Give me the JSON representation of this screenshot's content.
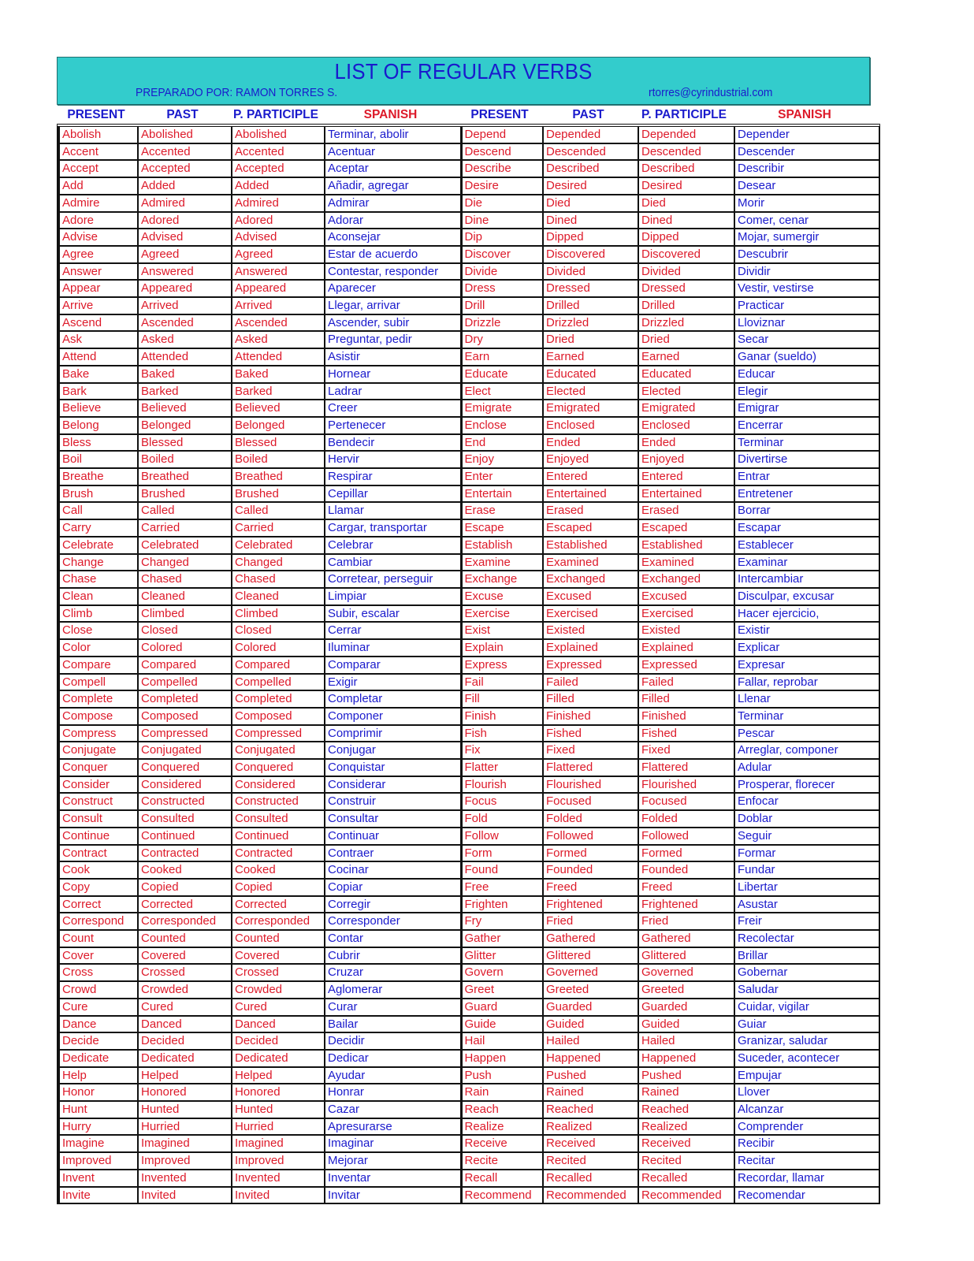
{
  "banner": {
    "title": "LIST OF REGULAR VERBS",
    "author": "PREPARADO POR: RAMON TORRES S.",
    "email": "rtorres@cyrindustrial.com"
  },
  "colors": {
    "banner_bg": "#33cccc",
    "english_text": "#dd1a2a",
    "spanish_text": "#1a1acc",
    "header_blue": "#1a1acc",
    "header_red": "#dd1a2a"
  },
  "headers": [
    "PRESENT",
    "PAST",
    "P. PARTICIPLE",
    "SPANISH",
    "PRESENT",
    "PAST",
    "P. PARTICIPLE",
    "SPANISH"
  ],
  "left_rows": [
    [
      "Abolish",
      "Abolished",
      "Abolished",
      "Terminar, abolir"
    ],
    [
      "Accent",
      "Accented",
      "Accented",
      "Acentuar"
    ],
    [
      "Accept",
      "Accepted",
      "Accepted",
      "Aceptar"
    ],
    [
      "Add",
      "Added",
      "Added",
      "Añadir, agregar"
    ],
    [
      "Admire",
      "Admired",
      "Admired",
      "Admirar"
    ],
    [
      "Adore",
      "Adored",
      "Adored",
      "Adorar"
    ],
    [
      "Advise",
      "Advised",
      "Advised",
      "Aconsejar"
    ],
    [
      "Agree",
      "Agreed",
      "Agreed",
      "Estar de acuerdo"
    ],
    [
      "Answer",
      "Answered",
      "Answered",
      "Contestar, responder"
    ],
    [
      "Appear",
      "Appeared",
      "Appeared",
      "Aparecer"
    ],
    [
      "Arrive",
      "Arrived",
      "Arrived",
      "Llegar, arrivar"
    ],
    [
      "Ascend",
      "Ascended",
      "Ascended",
      "Ascender, subir"
    ],
    [
      "Ask",
      "Asked",
      "Asked",
      "Preguntar, pedir"
    ],
    [
      "Attend",
      "Attended",
      "Attended",
      "Asistir"
    ],
    [
      "Bake",
      "Baked",
      "Baked",
      "Hornear"
    ],
    [
      "Bark",
      "Barked",
      "Barked",
      "Ladrar"
    ],
    [
      "Believe",
      "Believed",
      "Believed",
      "Creer"
    ],
    [
      "Belong",
      "Belonged",
      "Belonged",
      "Pertenecer"
    ],
    [
      "Bless",
      "Blessed",
      "Blessed",
      "Bendecir"
    ],
    [
      "Boil",
      "Boiled",
      "Boiled",
      "Hervir"
    ],
    [
      "Breathe",
      "Breathed",
      "Breathed",
      "Respirar"
    ],
    [
      "Brush",
      "Brushed",
      "Brushed",
      "Cepillar"
    ],
    [
      "Call",
      "Called",
      "Called",
      "Llamar"
    ],
    [
      "Carry",
      "Carried",
      "Carried",
      "Cargar, transportar"
    ],
    [
      "Celebrate",
      "Celebrated",
      "Celebrated",
      "Celebrar"
    ],
    [
      "Change",
      "Changed",
      "Changed",
      "Cambiar"
    ],
    [
      "Chase",
      "Chased",
      "Chased",
      "Corretear, perseguir"
    ],
    [
      "Clean",
      "Cleaned",
      "Cleaned",
      "Limpiar"
    ],
    [
      "Climb",
      "Climbed",
      "Climbed",
      "Subir, escalar"
    ],
    [
      "Close",
      "Closed",
      "Closed",
      "Cerrar"
    ],
    [
      "Color",
      "Colored",
      "Colored",
      "Iluminar"
    ],
    [
      "Compare",
      "Compared",
      "Compared",
      "Comparar"
    ],
    [
      "Compell",
      "Compelled",
      "Compelled",
      "Exigir"
    ],
    [
      "Complete",
      "Completed",
      "Completed",
      "Completar"
    ],
    [
      "Compose",
      "Composed",
      "Composed",
      "Componer"
    ],
    [
      "Compress",
      "Compressed",
      "Compressed",
      "Comprimir"
    ],
    [
      "Conjugate",
      "Conjugated",
      "Conjugated",
      "Conjugar"
    ],
    [
      "Conquer",
      "Conquered",
      "Conquered",
      "Conquistar"
    ],
    [
      "Consider",
      "Considered",
      "Considered",
      "Considerar"
    ],
    [
      "Construct",
      "Constructed",
      "Constructed",
      "Construir"
    ],
    [
      "Consult",
      "Consulted",
      "Consulted",
      "Consultar"
    ],
    [
      "Continue",
      "Continued",
      "Continued",
      "Continuar"
    ],
    [
      "Contract",
      "Contracted",
      "Contracted",
      "Contraer"
    ],
    [
      "Cook",
      "Cooked",
      "Cooked",
      "Cocinar"
    ],
    [
      "Copy",
      "Copied",
      "Copied",
      "Copiar"
    ],
    [
      "Correct",
      "Corrected",
      "Corrected",
      "Corregir"
    ],
    [
      "Correspond",
      "Corresponded",
      "Corresponded",
      "Corresponder"
    ],
    [
      "Count",
      "Counted",
      "Counted",
      "Contar"
    ],
    [
      "Cover",
      "Covered",
      "Covered",
      "Cubrir"
    ],
    [
      "Cross",
      "Crossed",
      "Crossed",
      "Cruzar"
    ],
    [
      "Crowd",
      "Crowded",
      "Crowded",
      "Aglomerar"
    ],
    [
      "Cure",
      "Cured",
      "Cured",
      "Curar"
    ],
    [
      "Dance",
      "Danced",
      "Danced",
      "Bailar"
    ],
    [
      "Decide",
      "Decided",
      "Decided",
      "Decidir"
    ],
    [
      "Dedicate",
      "Dedicated",
      "Dedicated",
      "Dedicar"
    ],
    [
      "Help",
      "Helped",
      "Helped",
      "Ayudar"
    ],
    [
      "Honor",
      "Honored",
      "Honored",
      "Honrar"
    ],
    [
      "Hunt",
      "Hunted",
      "Hunted",
      "Cazar"
    ],
    [
      "Hurry",
      "Hurried",
      "Hurried",
      "Apresurarse"
    ],
    [
      "Imagine",
      "Imagined",
      "Imagined",
      "Imaginar"
    ],
    [
      "Improved",
      "Improved",
      "Improved",
      "Mejorar"
    ],
    [
      "Invent",
      "Invented",
      "Invented",
      "Inventar"
    ],
    [
      "Invite",
      "Invited",
      "Invited",
      "Invitar"
    ]
  ],
  "right_rows": [
    [
      "Depend",
      "Depended",
      "Depended",
      "Depender"
    ],
    [
      "Descend",
      "Descended",
      "Descended",
      "Descender"
    ],
    [
      "Describe",
      "Described",
      "Described",
      "Describir"
    ],
    [
      "Desire",
      "Desired",
      "Desired",
      "Desear"
    ],
    [
      "Die",
      "Died",
      "Died",
      "Morir"
    ],
    [
      "Dine",
      "Dined",
      "Dined",
      "Comer, cenar"
    ],
    [
      "Dip",
      "Dipped",
      "Dipped",
      "Mojar, sumergir"
    ],
    [
      "Discover",
      "Discovered",
      "Discovered",
      "Descubrir"
    ],
    [
      "Divide",
      "Divided",
      "Divided",
      "Dividir"
    ],
    [
      "Dress",
      "Dressed",
      "Dressed",
      "Vestir, vestirse"
    ],
    [
      "Drill",
      "Drilled",
      "Drilled",
      "Practicar"
    ],
    [
      "Drizzle",
      "Drizzled",
      "Drizzled",
      "Lloviznar"
    ],
    [
      "Dry",
      "Dried",
      "Dried",
      "Secar"
    ],
    [
      "Earn",
      "Earned",
      "Earned",
      "Ganar (sueldo)"
    ],
    [
      "Educate",
      "Educated",
      "Educated",
      "Educar"
    ],
    [
      "Elect",
      "Elected",
      "Elected",
      "Elegir"
    ],
    [
      "Emigrate",
      "Emigrated",
      "Emigrated",
      "Emigrar"
    ],
    [
      "Enclose",
      "Enclosed",
      "Enclosed",
      "Encerrar"
    ],
    [
      "End",
      "Ended",
      "Ended",
      "Terminar"
    ],
    [
      "Enjoy",
      "Enjoyed",
      "Enjoyed",
      "Divertirse"
    ],
    [
      "Enter",
      "Entered",
      "Entered",
      "Entrar"
    ],
    [
      "Entertain",
      "Entertained",
      "Entertained",
      "Entretener"
    ],
    [
      "Erase",
      "Erased",
      "Erased",
      "Borrar"
    ],
    [
      "Escape",
      "Escaped",
      "Escaped",
      "Escapar"
    ],
    [
      "Establish",
      "Established",
      "Established",
      "Establecer"
    ],
    [
      "Examine",
      "Examined",
      "Examined",
      "Examinar"
    ],
    [
      "Exchange",
      "Exchanged",
      "Exchanged",
      "Intercambiar"
    ],
    [
      "Excuse",
      "Excused",
      "Excused",
      "Disculpar, excusar"
    ],
    [
      "Exercise",
      "Exercised",
      "Exercised",
      "Hacer ejercicio,"
    ],
    [
      "Exist",
      "Existed",
      "Existed",
      "Existir"
    ],
    [
      "Explain",
      "Explained",
      "Explained",
      "Explicar"
    ],
    [
      "Express",
      "Expressed",
      "Expressed",
      "Expresar"
    ],
    [
      "Fail",
      "Failed",
      "Failed",
      "Fallar, reprobar"
    ],
    [
      "Fill",
      "Filled",
      "Filled",
      "Llenar"
    ],
    [
      "Finish",
      "Finished",
      "Finished",
      "Terminar"
    ],
    [
      "Fish",
      "Fished",
      "Fished",
      "Pescar"
    ],
    [
      "Fix",
      "Fixed",
      "Fixed",
      "Arreglar, componer"
    ],
    [
      "Flatter",
      "Flattered",
      "Flattered",
      "Adular"
    ],
    [
      "Flourish",
      "Flourished",
      "Flourished",
      "Prosperar, florecer"
    ],
    [
      "Focus",
      "Focused",
      "Focused",
      "Enfocar"
    ],
    [
      "Fold",
      "Folded",
      "Folded",
      "Doblar"
    ],
    [
      "Follow",
      "Followed",
      "Followed",
      "Seguir"
    ],
    [
      "Form",
      "Formed",
      "Formed",
      "Formar"
    ],
    [
      "Found",
      "Founded",
      "Founded",
      "Fundar"
    ],
    [
      "Free",
      "Freed",
      "Freed",
      "Libertar"
    ],
    [
      "Frighten",
      "Frightened",
      "Frightened",
      "Asustar"
    ],
    [
      "Fry",
      "Fried",
      "Fried",
      "Freir"
    ],
    [
      "Gather",
      "Gathered",
      "Gathered",
      "Recolectar"
    ],
    [
      "Glitter",
      "Glittered",
      "Glittered",
      "Brillar"
    ],
    [
      "Govern",
      "Governed",
      "Governed",
      "Gobernar"
    ],
    [
      "Greet",
      "Greeted",
      "Greeted",
      "Saludar"
    ],
    [
      "Guard",
      "Guarded",
      "Guarded",
      "Cuidar, vigilar"
    ],
    [
      "Guide",
      "Guided",
      "Guided",
      "Guiar"
    ],
    [
      "Hail",
      "Hailed",
      "Hailed",
      "Granizar, saludar"
    ],
    [
      "Happen",
      "Happened",
      "Happened",
      "Suceder, acontecer"
    ],
    [
      "Push",
      "Pushed",
      "Pushed",
      "Empujar"
    ],
    [
      "Rain",
      "Rained",
      "Rained",
      "Llover"
    ],
    [
      "Reach",
      "Reached",
      "Reached",
      "Alcanzar"
    ],
    [
      "Realize",
      "Realized",
      "Realized",
      "Comprender"
    ],
    [
      "Receive",
      "Received",
      "Received",
      "Recibir"
    ],
    [
      "Recite",
      "Recited",
      "Recited",
      "Recitar"
    ],
    [
      "Recall",
      "Recalled",
      "Recalled",
      "Recordar, llamar"
    ],
    [
      "Recommend",
      "Recommended",
      "Recommended",
      "Recomendar"
    ]
  ]
}
